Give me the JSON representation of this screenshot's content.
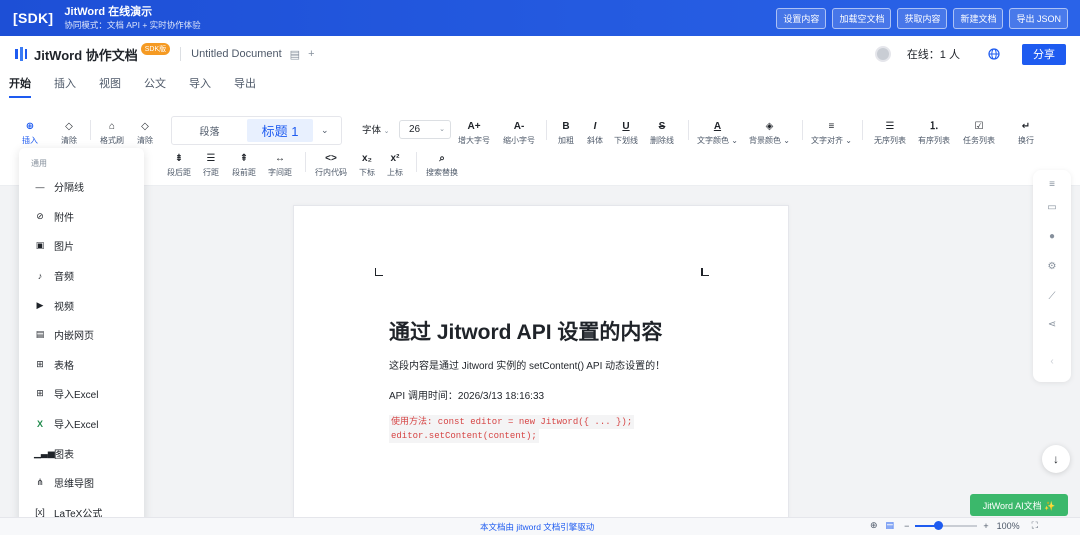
{
  "sdk": {
    "tag": "[SDK]",
    "title": "JitWord 在线演示",
    "subtitle": "协同模式：文档 API + 实时协作体验",
    "buttons": [
      "设置内容",
      "加载空文档",
      "获取内容",
      "新建文档",
      "导出 JSON"
    ]
  },
  "header": {
    "app_name": "JitWord 协作文档",
    "badge": "SDK版",
    "doc_name": "Untitled Document",
    "online": "在线：1 人",
    "share": "分享"
  },
  "menu_tabs": [
    "开始",
    "插入",
    "视图",
    "公文",
    "导入",
    "导出"
  ],
  "toolbar": {
    "insert": "插入",
    "clear1": "清除",
    "format_brush": "格式刷",
    "clear2": "清除",
    "para": "段落",
    "heading": "标题 1",
    "font": "字体",
    "font_size": "26",
    "inc_font": "增大字号",
    "dec_font": "缩小字号",
    "bold": "加粗",
    "italic": "斜体",
    "underline": "下划线",
    "strike": "删除线",
    "text_color": "文字颜色",
    "bg_color": "背景颜色",
    "align": "文字对齐",
    "ul": "无序列表",
    "ol": "有序列表",
    "task": "任务列表",
    "wrap": "换行",
    "space_after": "段后距",
    "line_height": "行距",
    "space_before": "段前距",
    "letter_spacing": "字间距",
    "inline_code": "行内代码",
    "subscript": "下标",
    "superscript": "上标",
    "search": "搜索替换"
  },
  "insert_panel": {
    "group": "通用",
    "items": [
      {
        "label": "分隔线",
        "icon": "divider-icon",
        "glyph": "—"
      },
      {
        "label": "附件",
        "icon": "paperclip-icon",
        "glyph": "⊘"
      },
      {
        "label": "图片",
        "icon": "image-icon",
        "glyph": "▣"
      },
      {
        "label": "音频",
        "icon": "music-icon",
        "glyph": "♪"
      },
      {
        "label": "视频",
        "icon": "video-icon",
        "glyph": "▶"
      },
      {
        "label": "内嵌网页",
        "icon": "webpage-icon",
        "glyph": "▤"
      },
      {
        "label": "表格",
        "icon": "table-icon",
        "glyph": "⊞"
      },
      {
        "label": "导入Excel",
        "icon": "grid-icon",
        "glyph": "⊞"
      },
      {
        "label": "导入Excel",
        "icon": "excel-icon",
        "glyph": "X"
      },
      {
        "label": "图表",
        "icon": "chart-icon",
        "glyph": "▁▃▅"
      },
      {
        "label": "思维导图",
        "icon": "mindmap-icon",
        "glyph": "⋔"
      },
      {
        "label": "LaTeX公式",
        "icon": "latex-icon",
        "glyph": "[x]"
      }
    ]
  },
  "document": {
    "heading": "通过 Jitword API 设置的内容",
    "para1": "这段内容是通过 Jitword 实例的 setContent() API 动态设置的！",
    "para2": "API 调用时间：2026/3/13 18:16:33",
    "code1": "使用方法: const editor = new Jitword({ ... });",
    "code2": "editor.setContent(content);"
  },
  "ai_button": "JitWord AI文档 ✨",
  "status": {
    "center": "本文档由 jitword 文档引擎驱动",
    "zoom": "100%",
    "zoom_level": 0.36
  },
  "colors": {
    "primary": "#1e5bf0",
    "sdk_bar": "#2a63e8",
    "ai_green": "#3bb86b",
    "code_red": "#d64545"
  }
}
